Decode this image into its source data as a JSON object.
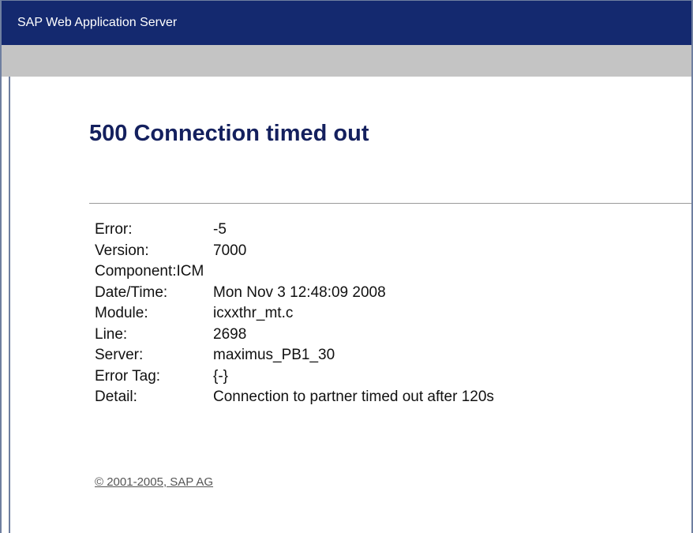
{
  "window": {
    "title": "SAP Web Application Server"
  },
  "error": {
    "heading": "500 Connection timed out",
    "details": [
      {
        "label": "Error:",
        "value": "-5"
      },
      {
        "label": "Version:",
        "value": "7000"
      },
      {
        "label": "Component:",
        "value": "ICM"
      },
      {
        "label": "Date/Time:",
        "value": "Mon Nov 3 12:48:09 2008"
      },
      {
        "label": "Module:",
        "value": "icxxthr_mt.c"
      },
      {
        "label": "Line:",
        "value": "2698"
      },
      {
        "label": "Server:",
        "value": "maximus_PB1_30"
      },
      {
        "label": "Error Tag:",
        "value": "{-}"
      },
      {
        "label": "Detail:",
        "value": "Connection to partner timed out after 120s"
      }
    ]
  },
  "footer": {
    "copyright": "© 2001-2005, SAP AG"
  },
  "colors": {
    "titlebar_bg": "#14296f",
    "heading_text": "#14205e",
    "graybar_bg": "#c4c4c4"
  }
}
